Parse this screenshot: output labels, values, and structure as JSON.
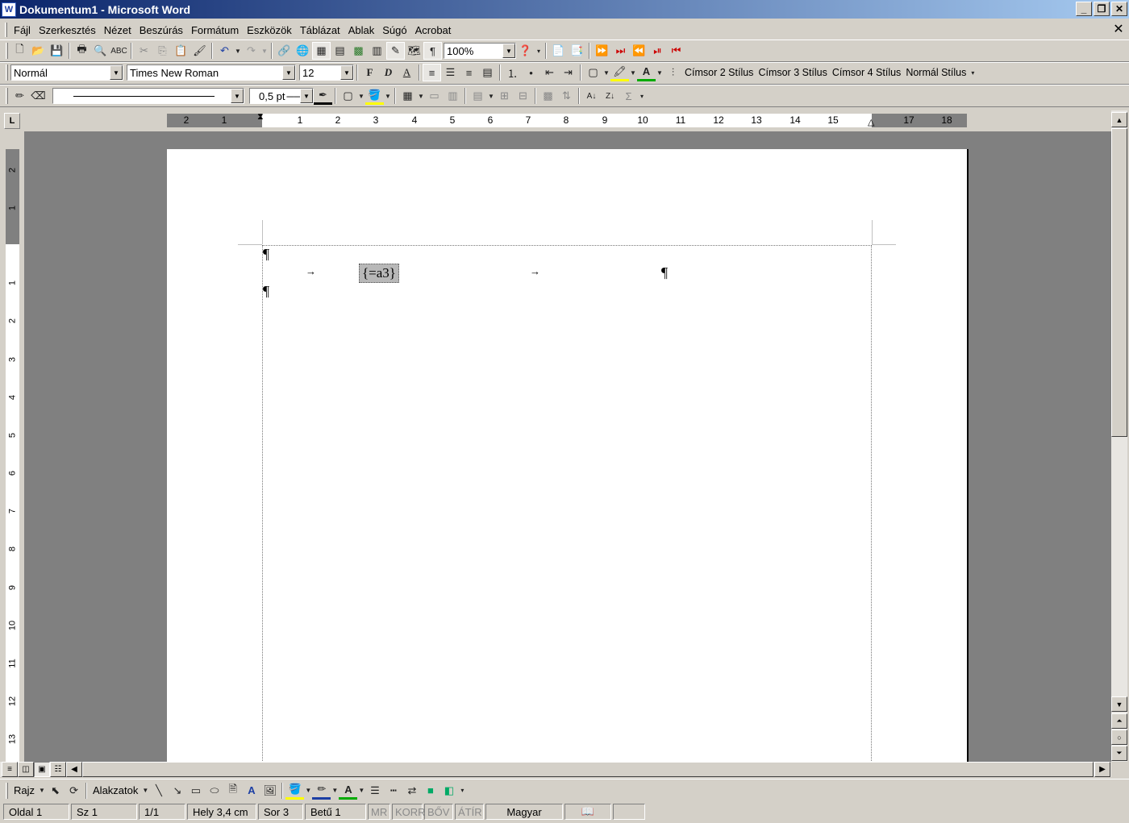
{
  "window": {
    "title": "Dokumentum1 - Microsoft Word",
    "app_icon": "W"
  },
  "menu": [
    "Fájl",
    "Szerkesztés",
    "Nézet",
    "Beszúrás",
    "Formátum",
    "Eszközök",
    "Táblázat",
    "Ablak",
    "Súgó",
    "Acrobat"
  ],
  "standard_toolbar": {
    "zoom": "100%"
  },
  "formatting_toolbar": {
    "style": "Normál",
    "font": "Times New Roman",
    "size": "12",
    "bold": "F",
    "italic": "D",
    "underline": "A",
    "styles": [
      "Címsor 2 Stílus",
      "Címsor 3 Stílus",
      "Címsor 4 Stílus",
      "Normál Stílus"
    ]
  },
  "tables_toolbar": {
    "line_weight": "0,5 pt"
  },
  "ruler": {
    "h_labels": [
      "2",
      "1",
      "1",
      "2",
      "3",
      "4",
      "5",
      "6",
      "7",
      "8",
      "9",
      "10",
      "11",
      "12",
      "13",
      "14",
      "15",
      "17",
      "18"
    ],
    "v_labels": [
      "2",
      "1",
      "1",
      "2",
      "3",
      "4",
      "5",
      "6",
      "7",
      "8",
      "9",
      "10",
      "11",
      "12",
      "13"
    ]
  },
  "document": {
    "pilcrow": "¶",
    "field_code": "{=a3}",
    "tab_arrow": "→"
  },
  "drawing_toolbar": {
    "draw_label": "Rajz",
    "shapes_label": "Alakzatok"
  },
  "status": {
    "page": "Oldal 1",
    "section": "Sz 1",
    "pages": "1/1",
    "position": "Hely 3,4 cm",
    "line": "Sor 3",
    "column": "Betű 1",
    "mr": "MR",
    "korr": "KORR",
    "bov": "BŐV",
    "atir": "ÁTÍR",
    "language": "Magyar"
  }
}
